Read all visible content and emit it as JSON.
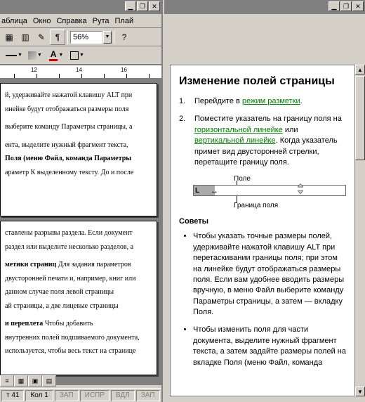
{
  "menu": {
    "items": [
      "аблица",
      "Окно",
      "Справка",
      "Рута",
      "Плай"
    ]
  },
  "zoom": "56%",
  "ruler_nums": [
    "12",
    "14",
    "16"
  ],
  "doc_page1": {
    "p1": "й, удерживайте нажатой клавишу ALT при",
    "p2": "инейке будут отображаться размеры поля",
    "p3": "выберите команду Параметры страницы, а",
    "p4a": "ента, выделите нужный фрагмент текста,",
    "p4b": "Поля (меню Файл, команда Параметры",
    "p4c": "араметр К выделенному тексту. До и после"
  },
  "doc_page2": {
    "p1": "ставлены разрывы раздела. Если документ",
    "p2": "раздел или выделите несколько разделов, а",
    "p3h": "метики страниц",
    "p3": "   Для задания параметров",
    "p4": "двусторонней печати и, например, книг или",
    "p5": "данном случае поля левой страницы",
    "p6": "ай страницы, а две лицевые страницы",
    "p7h": "и переплета",
    "p7": "   Чтобы добавить",
    "p8": "внутренних полей подшиваемого документа,",
    "p9": "используется, чтобы весь текст на странице"
  },
  "status": {
    "pos": "т 41",
    "col": "Кол 1",
    "cells": [
      "ЗАП",
      "ИСПР",
      "ВДЛ",
      "ЗАП"
    ]
  },
  "help": {
    "title": "Изменение полей страницы",
    "step1_a": "Перейдите в ",
    "step1_link": "режим разметки",
    "step1_b": ".",
    "step2_a": "Поместите указатель на границу поля на ",
    "step2_link1": "горизонтальной линейке",
    "step2_mid": " или ",
    "step2_link2": "вертикальной линейке",
    "step2_b": ". Когда указатель примет вид двусторонней стрелки, перетащите границу поля.",
    "diag_top": "Поле",
    "diag_bot": "Граница поля",
    "tips_h": "Советы",
    "tip1": "Чтобы указать точные размеры полей, удерживайте нажатой клавишу ALT при перетаскивании границы поля; при этом на линейке будут отображаться размеры поля. Если вам удобнее вводить размеры вручную, в меню Файл выберите команду Параметры страницы, а затем — вкладку Поля.",
    "tip2": "Чтобы изменить поля для части документа, выделите нужный фрагмент текста, а затем задайте размеры полей на вкладке Поля (меню Файл, команда"
  }
}
